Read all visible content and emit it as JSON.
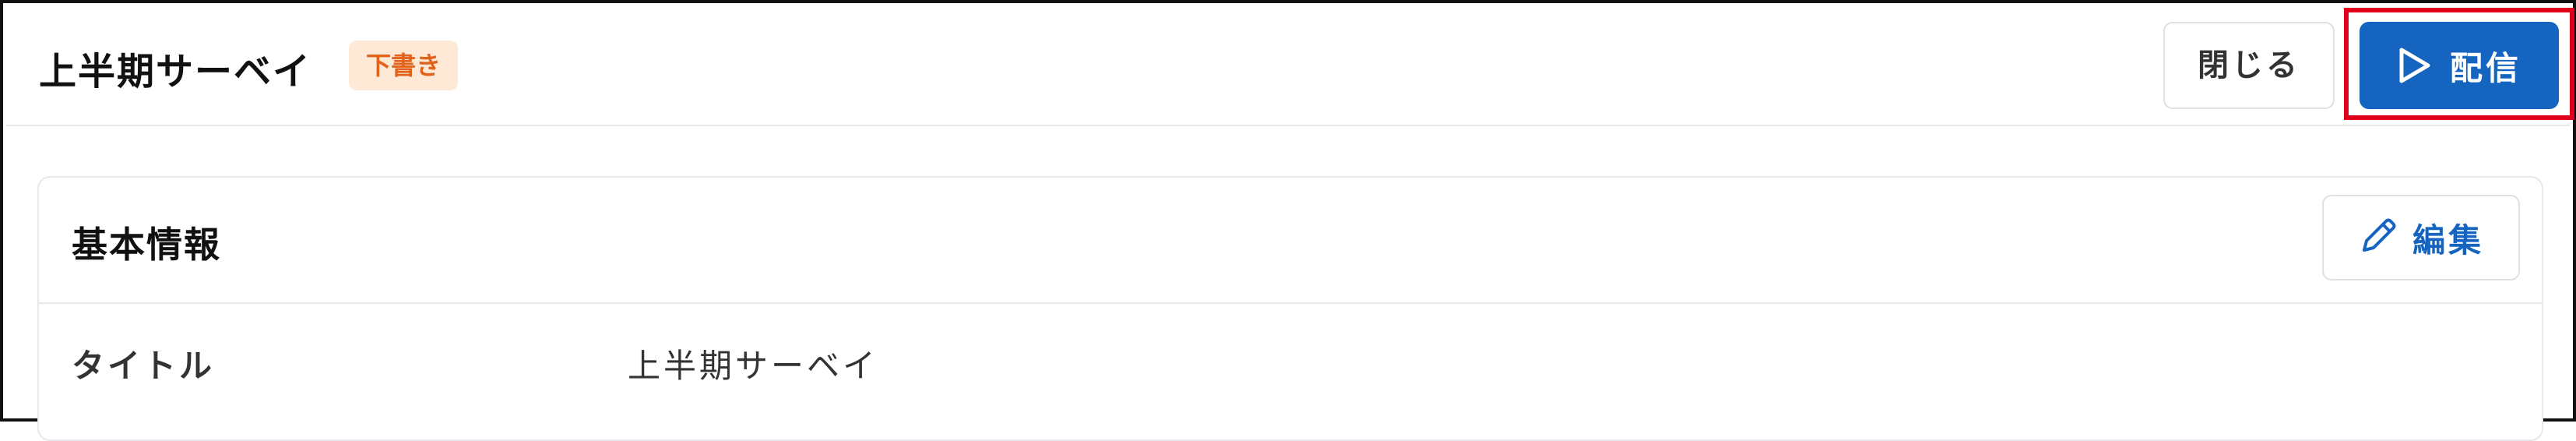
{
  "header": {
    "title": "上半期サーベイ",
    "badge": "下書き",
    "close_label": "閉じる",
    "deliver_label": "配信",
    "deliver_icon": "play-outline-icon"
  },
  "colors": {
    "primary": "#1565c0",
    "badge_text": "#e0621b",
    "badge_bg": "#fde9d6",
    "highlight": "#e0001b"
  },
  "basic_info": {
    "section_title": "基本情報",
    "edit_label": "編集",
    "edit_icon": "pencil-icon",
    "rows": [
      {
        "label": "タイトル",
        "value": "上半期サーベイ"
      }
    ]
  }
}
